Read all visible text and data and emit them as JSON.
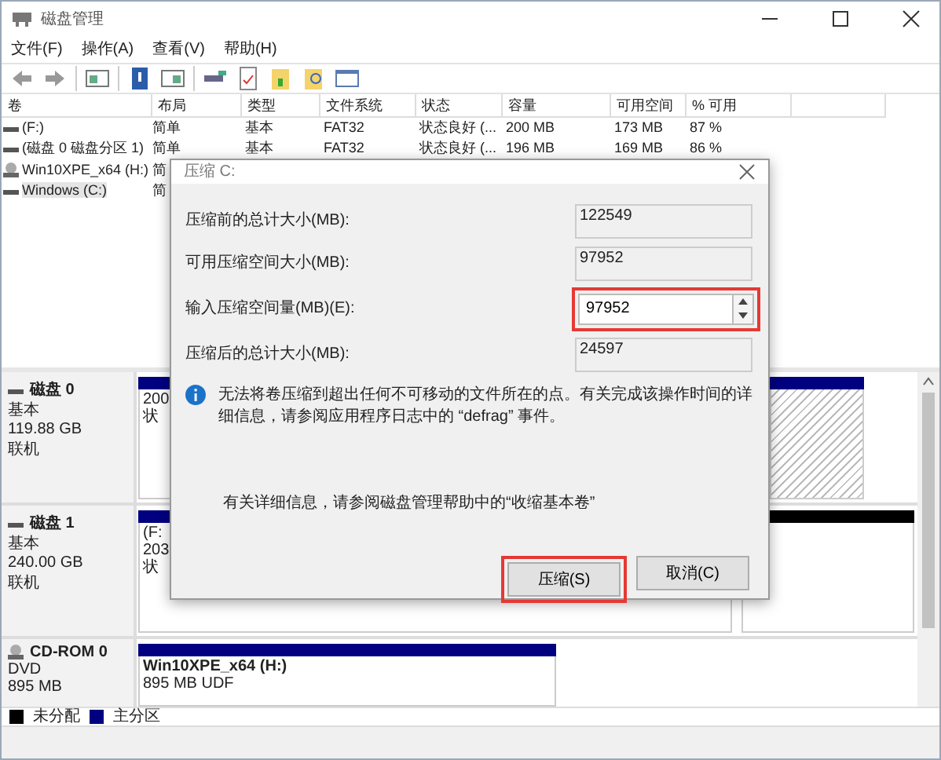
{
  "window": {
    "title": "磁盘管理"
  },
  "menu": [
    "文件(F)",
    "操作(A)",
    "查看(V)",
    "帮助(H)"
  ],
  "volume_table": {
    "columns": [
      "卷",
      "布局",
      "类型",
      "文件系统",
      "状态",
      "容量",
      "可用空间",
      "% 可用"
    ],
    "rows": [
      {
        "kind": "disk",
        "selected": false,
        "cells": [
          "(F:)",
          "简单",
          "基本",
          "FAT32",
          "状态良好 (...",
          "200 MB",
          "173 MB",
          "87 %"
        ]
      },
      {
        "kind": "disk",
        "selected": false,
        "cells": [
          "(磁盘 0 磁盘分区 1)",
          "简单",
          "基本",
          "FAT32",
          "状态良好 (...",
          "196 MB",
          "169 MB",
          "86 %"
        ]
      },
      {
        "kind": "cdrom",
        "selected": false,
        "cells": [
          "Win10XPE_x64 (H:)",
          "简"
        ]
      },
      {
        "kind": "disk",
        "selected": true,
        "cells": [
          "Windows (C:)",
          "简"
        ]
      }
    ]
  },
  "disks": [
    {
      "kind": "disk",
      "name": "磁盘 0",
      "type": "基本",
      "size": "119.88 GB",
      "status": "联机",
      "partitions": [
        {
          "kind": "primary",
          "selected": false,
          "lines": [
            "200",
            "状"
          ]
        },
        {
          "kind": "primary",
          "selected": true
        }
      ]
    },
    {
      "kind": "disk",
      "name": "磁盘 1",
      "type": "基本",
      "size": "240.00 GB",
      "status": "联机",
      "partitions": [
        {
          "kind": "primary",
          "selected": false,
          "lines": [
            "(F:",
            "203",
            "状"
          ]
        },
        {
          "kind": "unallocated",
          "selected": false
        }
      ]
    },
    {
      "kind": "cdrom",
      "name": "CD-ROM 0",
      "type": "DVD",
      "size": "895 MB",
      "partitions": [
        {
          "kind": "primary",
          "selected": false,
          "title": "Win10XPE_x64  (H:)",
          "lines": [
            "895 MB UDF"
          ]
        }
      ]
    }
  ],
  "legend": [
    {
      "label": "未分配",
      "color": "#000000"
    },
    {
      "label": "主分区",
      "color": "#000080"
    }
  ],
  "dialog": {
    "title": "压缩 C:",
    "fields": [
      {
        "kind": "readonly",
        "label": "压缩前的总计大小(MB):",
        "value": "122549"
      },
      {
        "kind": "readonly",
        "label": "可用压缩空间大小(MB):",
        "value": "97952"
      },
      {
        "kind": "spin",
        "label": "输入压缩空间量(MB)(E):",
        "value": "97952",
        "highlighted": true
      },
      {
        "kind": "readonly",
        "label": "压缩后的总计大小(MB):",
        "value": "24597"
      }
    ],
    "info": "无法将卷压缩到超出任何不可移动的文件所在的点。有关完成该操作时间的详细信息，请参阅应用程序日志中的 “defrag” 事件。",
    "help": "有关详细信息，请参阅磁盘管理帮助中的“收缩基本卷”",
    "buttons": [
      {
        "label": "压缩(S)",
        "highlighted": true
      },
      {
        "label": "取消(C)",
        "highlighted": false
      }
    ]
  }
}
